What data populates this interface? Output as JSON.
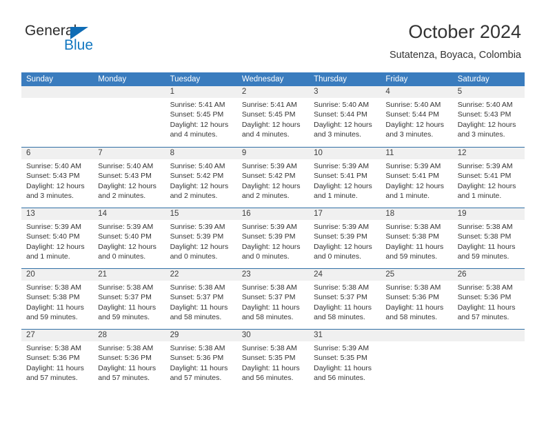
{
  "brand": {
    "name_top": "General",
    "name_bottom": "Blue",
    "accent_color": "#1277c0",
    "triangle_color": "#0f6cb5"
  },
  "header": {
    "title": "October 2024",
    "subtitle": "Sutatenza, Boyaca, Colombia"
  },
  "calendar": {
    "header_bg": "#3a7cbe",
    "separator_color": "#2e6da4",
    "daynum_bg": "#f0f0f0",
    "weekdays": [
      "Sunday",
      "Monday",
      "Tuesday",
      "Wednesday",
      "Thursday",
      "Friday",
      "Saturday"
    ],
    "weeks": [
      [
        {
          "day": "",
          "sunrise": "",
          "sunset": "",
          "daylight1": "",
          "daylight2": "",
          "empty": true
        },
        {
          "day": "",
          "sunrise": "",
          "sunset": "",
          "daylight1": "",
          "daylight2": "",
          "empty": true
        },
        {
          "day": "1",
          "sunrise": "Sunrise: 5:41 AM",
          "sunset": "Sunset: 5:45 PM",
          "daylight1": "Daylight: 12 hours",
          "daylight2": "and 4 minutes."
        },
        {
          "day": "2",
          "sunrise": "Sunrise: 5:41 AM",
          "sunset": "Sunset: 5:45 PM",
          "daylight1": "Daylight: 12 hours",
          "daylight2": "and 4 minutes."
        },
        {
          "day": "3",
          "sunrise": "Sunrise: 5:40 AM",
          "sunset": "Sunset: 5:44 PM",
          "daylight1": "Daylight: 12 hours",
          "daylight2": "and 3 minutes."
        },
        {
          "day": "4",
          "sunrise": "Sunrise: 5:40 AM",
          "sunset": "Sunset: 5:44 PM",
          "daylight1": "Daylight: 12 hours",
          "daylight2": "and 3 minutes."
        },
        {
          "day": "5",
          "sunrise": "Sunrise: 5:40 AM",
          "sunset": "Sunset: 5:43 PM",
          "daylight1": "Daylight: 12 hours",
          "daylight2": "and 3 minutes."
        }
      ],
      [
        {
          "day": "6",
          "sunrise": "Sunrise: 5:40 AM",
          "sunset": "Sunset: 5:43 PM",
          "daylight1": "Daylight: 12 hours",
          "daylight2": "and 3 minutes."
        },
        {
          "day": "7",
          "sunrise": "Sunrise: 5:40 AM",
          "sunset": "Sunset: 5:43 PM",
          "daylight1": "Daylight: 12 hours",
          "daylight2": "and 2 minutes."
        },
        {
          "day": "8",
          "sunrise": "Sunrise: 5:40 AM",
          "sunset": "Sunset: 5:42 PM",
          "daylight1": "Daylight: 12 hours",
          "daylight2": "and 2 minutes."
        },
        {
          "day": "9",
          "sunrise": "Sunrise: 5:39 AM",
          "sunset": "Sunset: 5:42 PM",
          "daylight1": "Daylight: 12 hours",
          "daylight2": "and 2 minutes."
        },
        {
          "day": "10",
          "sunrise": "Sunrise: 5:39 AM",
          "sunset": "Sunset: 5:41 PM",
          "daylight1": "Daylight: 12 hours",
          "daylight2": "and 1 minute."
        },
        {
          "day": "11",
          "sunrise": "Sunrise: 5:39 AM",
          "sunset": "Sunset: 5:41 PM",
          "daylight1": "Daylight: 12 hours",
          "daylight2": "and 1 minute."
        },
        {
          "day": "12",
          "sunrise": "Sunrise: 5:39 AM",
          "sunset": "Sunset: 5:41 PM",
          "daylight1": "Daylight: 12 hours",
          "daylight2": "and 1 minute."
        }
      ],
      [
        {
          "day": "13",
          "sunrise": "Sunrise: 5:39 AM",
          "sunset": "Sunset: 5:40 PM",
          "daylight1": "Daylight: 12 hours",
          "daylight2": "and 1 minute."
        },
        {
          "day": "14",
          "sunrise": "Sunrise: 5:39 AM",
          "sunset": "Sunset: 5:40 PM",
          "daylight1": "Daylight: 12 hours",
          "daylight2": "and 0 minutes."
        },
        {
          "day": "15",
          "sunrise": "Sunrise: 5:39 AM",
          "sunset": "Sunset: 5:39 PM",
          "daylight1": "Daylight: 12 hours",
          "daylight2": "and 0 minutes."
        },
        {
          "day": "16",
          "sunrise": "Sunrise: 5:39 AM",
          "sunset": "Sunset: 5:39 PM",
          "daylight1": "Daylight: 12 hours",
          "daylight2": "and 0 minutes."
        },
        {
          "day": "17",
          "sunrise": "Sunrise: 5:39 AM",
          "sunset": "Sunset: 5:39 PM",
          "daylight1": "Daylight: 12 hours",
          "daylight2": "and 0 minutes."
        },
        {
          "day": "18",
          "sunrise": "Sunrise: 5:38 AM",
          "sunset": "Sunset: 5:38 PM",
          "daylight1": "Daylight: 11 hours",
          "daylight2": "and 59 minutes."
        },
        {
          "day": "19",
          "sunrise": "Sunrise: 5:38 AM",
          "sunset": "Sunset: 5:38 PM",
          "daylight1": "Daylight: 11 hours",
          "daylight2": "and 59 minutes."
        }
      ],
      [
        {
          "day": "20",
          "sunrise": "Sunrise: 5:38 AM",
          "sunset": "Sunset: 5:38 PM",
          "daylight1": "Daylight: 11 hours",
          "daylight2": "and 59 minutes."
        },
        {
          "day": "21",
          "sunrise": "Sunrise: 5:38 AM",
          "sunset": "Sunset: 5:37 PM",
          "daylight1": "Daylight: 11 hours",
          "daylight2": "and 59 minutes."
        },
        {
          "day": "22",
          "sunrise": "Sunrise: 5:38 AM",
          "sunset": "Sunset: 5:37 PM",
          "daylight1": "Daylight: 11 hours",
          "daylight2": "and 58 minutes."
        },
        {
          "day": "23",
          "sunrise": "Sunrise: 5:38 AM",
          "sunset": "Sunset: 5:37 PM",
          "daylight1": "Daylight: 11 hours",
          "daylight2": "and 58 minutes."
        },
        {
          "day": "24",
          "sunrise": "Sunrise: 5:38 AM",
          "sunset": "Sunset: 5:37 PM",
          "daylight1": "Daylight: 11 hours",
          "daylight2": "and 58 minutes."
        },
        {
          "day": "25",
          "sunrise": "Sunrise: 5:38 AM",
          "sunset": "Sunset: 5:36 PM",
          "daylight1": "Daylight: 11 hours",
          "daylight2": "and 58 minutes."
        },
        {
          "day": "26",
          "sunrise": "Sunrise: 5:38 AM",
          "sunset": "Sunset: 5:36 PM",
          "daylight1": "Daylight: 11 hours",
          "daylight2": "and 57 minutes."
        }
      ],
      [
        {
          "day": "27",
          "sunrise": "Sunrise: 5:38 AM",
          "sunset": "Sunset: 5:36 PM",
          "daylight1": "Daylight: 11 hours",
          "daylight2": "and 57 minutes."
        },
        {
          "day": "28",
          "sunrise": "Sunrise: 5:38 AM",
          "sunset": "Sunset: 5:36 PM",
          "daylight1": "Daylight: 11 hours",
          "daylight2": "and 57 minutes."
        },
        {
          "day": "29",
          "sunrise": "Sunrise: 5:38 AM",
          "sunset": "Sunset: 5:36 PM",
          "daylight1": "Daylight: 11 hours",
          "daylight2": "and 57 minutes."
        },
        {
          "day": "30",
          "sunrise": "Sunrise: 5:38 AM",
          "sunset": "Sunset: 5:35 PM",
          "daylight1": "Daylight: 11 hours",
          "daylight2": "and 56 minutes."
        },
        {
          "day": "31",
          "sunrise": "Sunrise: 5:39 AM",
          "sunset": "Sunset: 5:35 PM",
          "daylight1": "Daylight: 11 hours",
          "daylight2": "and 56 minutes."
        },
        {
          "day": "",
          "sunrise": "",
          "sunset": "",
          "daylight1": "",
          "daylight2": "",
          "empty": true
        },
        {
          "day": "",
          "sunrise": "",
          "sunset": "",
          "daylight1": "",
          "daylight2": "",
          "empty": true
        }
      ]
    ]
  }
}
